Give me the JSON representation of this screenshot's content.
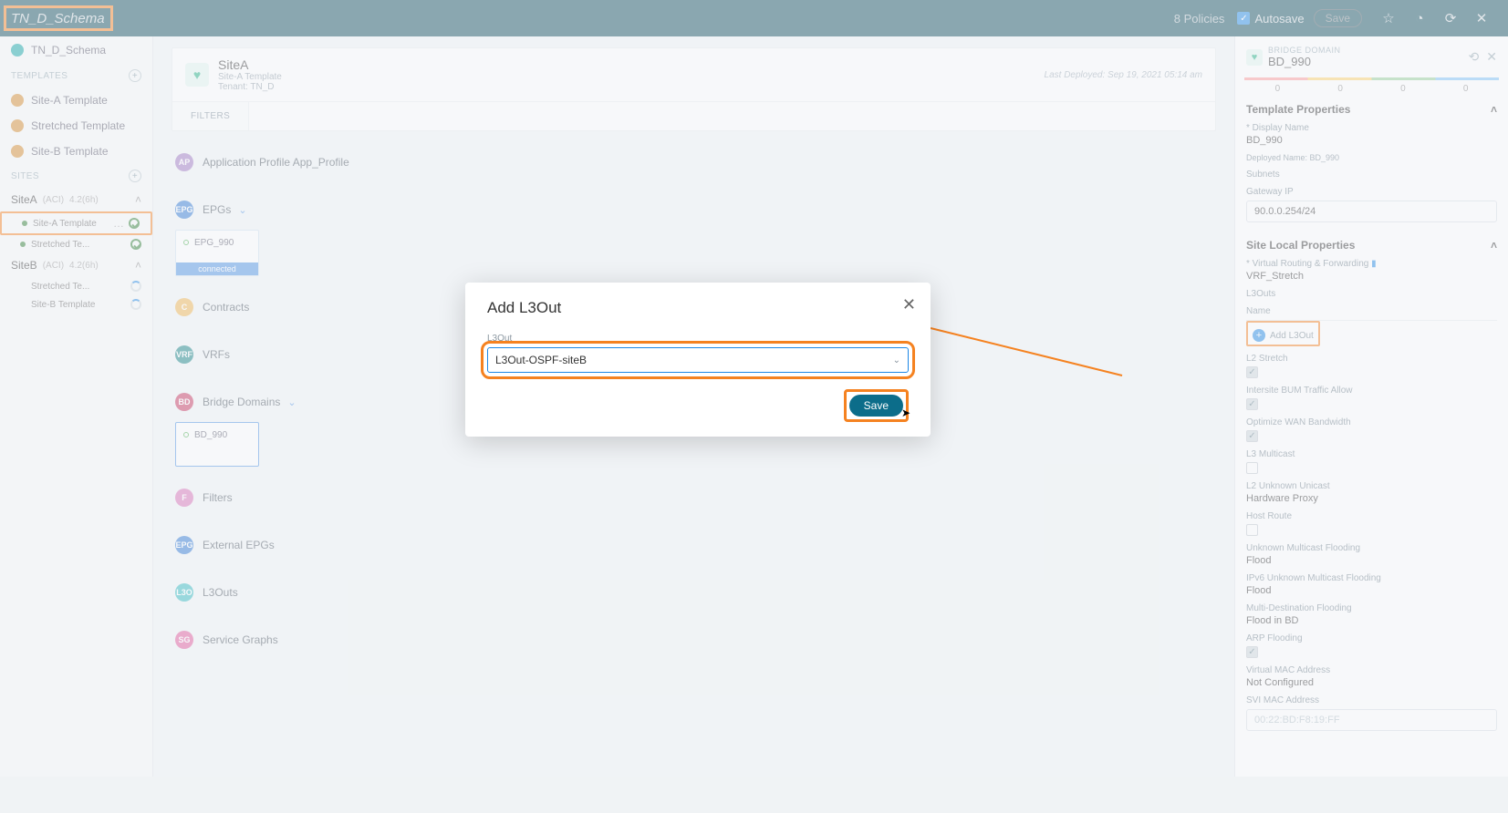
{
  "topbar": {
    "title": "TN_D_Schema",
    "policies": "8 Policies",
    "autosave": "Autosave",
    "save": "Save"
  },
  "sidebar": {
    "schema": "TN_D_Schema",
    "templates_header": "TEMPLATES",
    "templates": [
      "Site-A Template",
      "Stretched Template",
      "Site-B Template"
    ],
    "sites_header": "SITES",
    "siteA": {
      "name": "SiteA",
      "api": "(ACI)",
      "ver": "4.2(6h)"
    },
    "siteA_subs": [
      {
        "label": "Site-A Template",
        "status": "ok-sel"
      },
      {
        "label": "Stretched Te...",
        "status": "ok"
      }
    ],
    "siteB": {
      "name": "SiteB",
      "api": "(ACI)",
      "ver": "4.2(6h)"
    },
    "siteB_subs": [
      {
        "label": "Stretched Te...",
        "status": "spin"
      },
      {
        "label": "Site-B Template",
        "status": "spin"
      }
    ]
  },
  "header": {
    "site": "SiteA",
    "tpl": "Site-A Template",
    "tenant": "Tenant: TN_D",
    "deployed": "Last Deployed: Sep 19, 2021 05:14 am",
    "filters": "FILTERS"
  },
  "sections": {
    "ap": "Application Profile App_Profile",
    "epgs": "EPGs",
    "epg_tile": "EPG_990",
    "epg_conn": "connected",
    "contracts": "Contracts",
    "vrfs": "VRFs",
    "bds": "Bridge Domains",
    "bd_tile": "BD_990",
    "filters": "Filters",
    "eepgs": "External EPGs",
    "l3outs": "L3Outs",
    "sg": "Service Graphs"
  },
  "modal": {
    "title": "Add L3Out",
    "field": "L3Out",
    "value": "L3Out-OSPF-siteB",
    "save": "Save"
  },
  "rpanel": {
    "kind": "BRIDGE DOMAIN",
    "name": "BD_990",
    "nums": [
      "0",
      "0",
      "0",
      "0"
    ],
    "tp_head": "Template Properties",
    "disp_lbl": "* Display Name",
    "disp_val": "BD_990",
    "dep_name": "Deployed Name: BD_990",
    "subnets_lbl": "Subnets",
    "gw_lbl": "Gateway IP",
    "gw_val": "90.0.0.254/24",
    "slp_head": "Site Local Properties",
    "vrf_lbl": "* Virtual Routing & Forwarding",
    "vrf_val": "VRF_Stretch",
    "l3outs_lbl": "L3Outs",
    "name_lbl": "Name",
    "add_l3": "Add L3Out",
    "p": {
      "l2s": "L2 Stretch",
      "ibum": "Intersite BUM Traffic Allow",
      "owan": "Optimize WAN Bandwidth",
      "l3m": "L3 Multicast",
      "l2u_lbl": "L2 Unknown Unicast",
      "l2u_val": "Hardware Proxy",
      "hr": "Host Route",
      "umf_lbl": "Unknown Multicast Flooding",
      "umf_val": "Flood",
      "ipv6_lbl": "IPv6 Unknown Multicast Flooding",
      "ipv6_val": "Flood",
      "mdf_lbl": "Multi-Destination Flooding",
      "mdf_val": "Flood in BD",
      "arp": "ARP Flooding",
      "vmac_lbl": "Virtual MAC Address",
      "vmac_val": "Not Configured",
      "svi_lbl": "SVI MAC Address",
      "svi_val": "00:22:BD:F8:19:FF"
    }
  }
}
